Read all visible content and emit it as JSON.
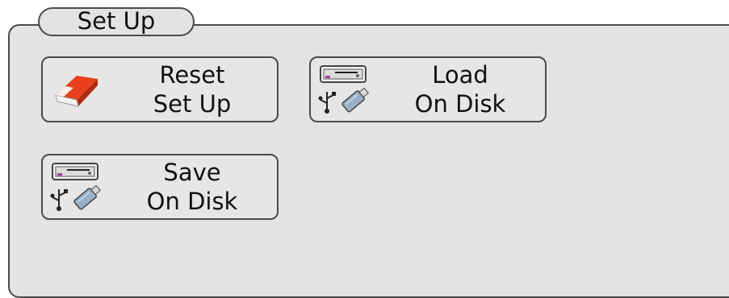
{
  "group": {
    "title": "Set Up"
  },
  "buttons": {
    "reset": {
      "line1": "Reset",
      "line2": "Set Up",
      "icon": "eraser-icon"
    },
    "load": {
      "line1": "Load",
      "line2": "On Disk",
      "icon": "disk-usb-icon"
    },
    "save": {
      "line1": "Save",
      "line2": "On Disk",
      "icon": "disk-usb-icon"
    }
  },
  "colors": {
    "panel_bg": "#e3e3e3",
    "border": "#4a4a4a",
    "eraser_red": "#e8401c"
  }
}
